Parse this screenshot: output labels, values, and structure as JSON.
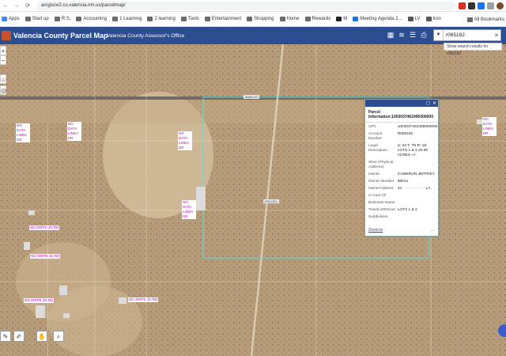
{
  "browser": {
    "url": "arcgisce2.co.valencia.nm.us/parcelmap/",
    "bookmarks": [
      "Apps",
      "Start up",
      "R.S.",
      "Accounting",
      "1 Learning",
      "2 learning",
      "Tools",
      "Entertainment",
      "Shopping",
      "Home",
      "Rewards",
      "M",
      "Meeting Agenda 2...",
      "LV",
      "Iron"
    ],
    "all_bookmarks": "All Bookmarks"
  },
  "app": {
    "title": "Valencia County Parcel Map",
    "subtitle": "Valencia County Assessor's Office",
    "search_value": "r065182",
    "search_suggestion": "Show search results for r065182"
  },
  "map": {
    "road_labels": [
      "MAIN ST",
      "RIO DEL",
      "RD"
    ],
    "parcel_labels": [
      "NO DATA LINDA DR",
      "NO DATA LINDA DR",
      "NO DATA LINDA DR",
      "NO DATA LINDA DR",
      "NO SRIPE JO RD",
      "NO SRIPE JO RD",
      "NO SRIPE JO RD",
      "NO SRIPE JO RD",
      "NO DATA LINDA DR"
    ],
    "zoom_in": "+",
    "zoom_out": "−"
  },
  "popup": {
    "title": "Parcel Information:1003037462495000000",
    "fields": [
      {
        "label": "UPC",
        "value": "1003037462495000000"
      },
      {
        "label": "Account Number",
        "value": "R065182"
      },
      {
        "label": "Legal Description",
        "value": "S: 33 T: 7N R: 1E LOTS 1 & 2 20.00 ACRES +/-"
      },
      {
        "label": "Situs (Physical Address)",
        "value": ""
      },
      {
        "label": "Owner",
        "value": "CAMERON JEFFREY"
      },
      {
        "label": "Owner Number",
        "value": "99014"
      },
      {
        "label": "OwnerAddress",
        "value": "43 · · · · · · · · · · LA"
      },
      {
        "label": "In Care Of",
        "value": ""
      },
      {
        "label": "Business Name",
        "value": ""
      },
      {
        "label": "Tract/Lot/Parcel",
        "value": "LOTS 1 & 2"
      },
      {
        "label": "Subdivision",
        "value": ""
      }
    ],
    "zoom_to": "Zoom to",
    "more": "···"
  }
}
